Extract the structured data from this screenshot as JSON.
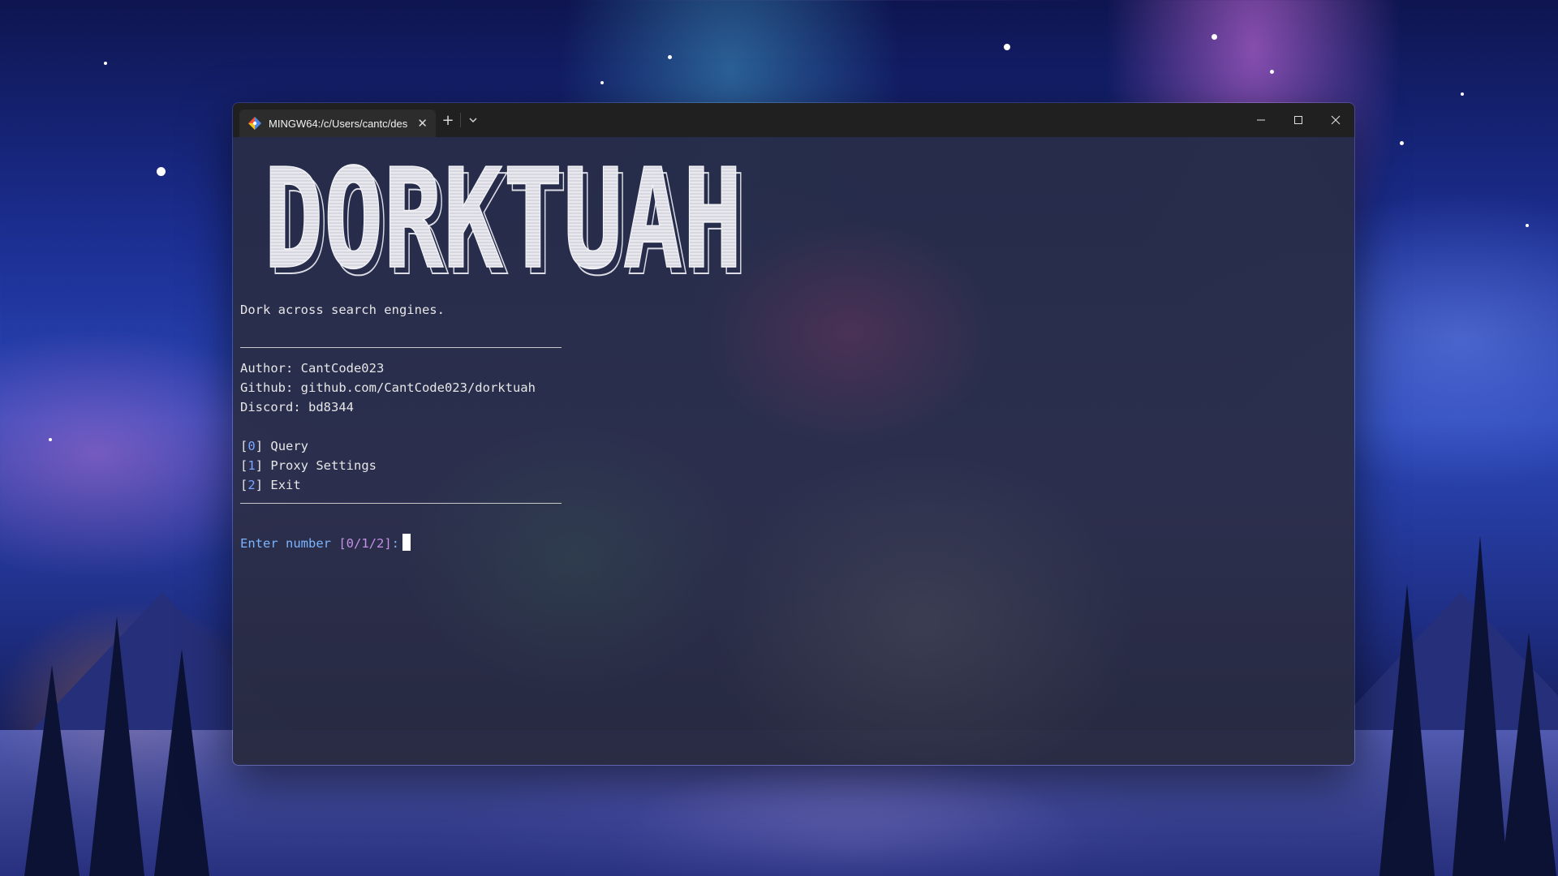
{
  "window": {
    "tab_title": "MINGW64:/c/Users/cantc/des",
    "tab_icon": "git-bash-icon",
    "new_tab_label": "+",
    "dropdown_icon": "chevron-down-icon"
  },
  "terminal": {
    "banner": "DORKTUAH",
    "tagline": "Dork across search engines.",
    "author": "Author: CantCode023",
    "github": "Github: github.com/CantCode023/dorktuah",
    "discord": "Discord: bd8344",
    "menu": [
      {
        "key": "0",
        "label": "Query"
      },
      {
        "key": "1",
        "label": "Proxy Settings"
      },
      {
        "key": "2",
        "label": "Exit"
      }
    ],
    "prompt_text": "Enter number",
    "prompt_options": "[0/1/2]",
    "prompt_suffix": ":"
  },
  "colors": {
    "menu_number": "#7aa7ff",
    "prompt": "#7ab4ff",
    "prompt_options": "#c690e8"
  }
}
